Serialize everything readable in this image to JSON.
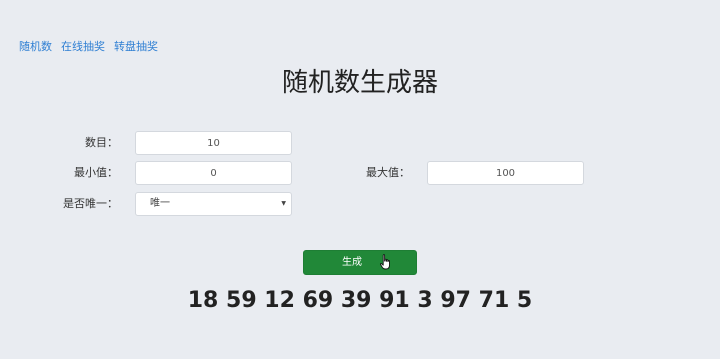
{
  "nav": {
    "items": [
      {
        "label": "随机数"
      },
      {
        "label": "在线抽奖"
      },
      {
        "label": "转盘抽奖"
      }
    ]
  },
  "page": {
    "title": "随机数生成器"
  },
  "form": {
    "count": {
      "label": "数目：",
      "value": "10"
    },
    "min": {
      "label": "最小值：",
      "value": "0"
    },
    "max": {
      "label": "最大值：",
      "value": "100"
    },
    "unique": {
      "label": "是否唯一：",
      "selected": "唯一"
    }
  },
  "actions": {
    "generate_label": "生成"
  },
  "result": {
    "numbers": "18 59 12 69 39 91 3 97 71 5"
  },
  "colors": {
    "background": "#e9ecf1",
    "link": "#2f7fd3",
    "button": "#218838"
  },
  "icons": {
    "select_arrow": "chevron-down-icon",
    "cursor": "hand-pointer-icon"
  }
}
